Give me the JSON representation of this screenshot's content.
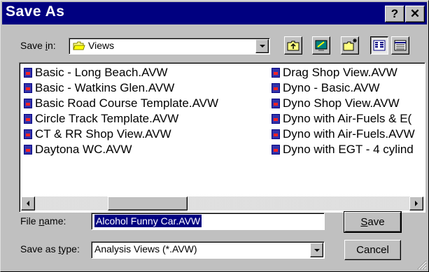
{
  "dialog": {
    "title": "Save As",
    "help_label": "?",
    "close_label": "✕"
  },
  "save_in": {
    "label_pre": "Save ",
    "label_accel": "i",
    "label_post": "n:",
    "value": "Views"
  },
  "toolbar": {
    "up_icon": "up-folder-icon",
    "desktop_icon": "desktop-icon",
    "new_folder_icon": "new-folder-icon",
    "list_view_icon": "list-view-icon",
    "details_view_icon": "details-view-icon"
  },
  "files": {
    "col1": [
      "Basic - Long Beach.AVW",
      "Basic - Watkins Glen.AVW",
      "Basic Road Course Template.AVW",
      "Circle Track Template.AVW",
      "CT & RR Shop View.AVW",
      "Daytona WC.AVW"
    ],
    "col2": [
      "Drag Shop View.AVW",
      "Dyno - Basic.AVW",
      "Dyno Shop View.AVW",
      "Dyno with Air-Fuels & E(",
      "Dyno with Air-Fuels.AVW",
      "Dyno with EGT - 4 cylind"
    ]
  },
  "file_name": {
    "label_pre": "File ",
    "label_accel": "n",
    "label_post": "ame:",
    "value": "Alcohol Funny Car.AVW"
  },
  "save_type": {
    "label_pre": "Save as ",
    "label_accel": "t",
    "label_post": "ype:",
    "value": "Analysis Views (*.AVW)"
  },
  "buttons": {
    "save_accel": "S",
    "save_rest": "ave",
    "cancel": "Cancel"
  },
  "colors": {
    "titlebar": "#000080",
    "face": "#c0c0c0",
    "selection": "#000080"
  }
}
